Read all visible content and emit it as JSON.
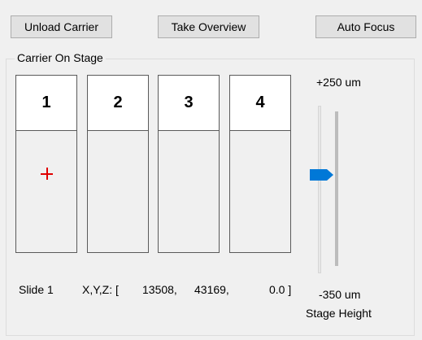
{
  "toolbar": {
    "unload_label": "Unload Carrier",
    "overview_label": "Take Overview",
    "autofocus_label": "Auto Focus"
  },
  "carrier": {
    "group_title": "Carrier On Stage",
    "slots": [
      {
        "label": "1",
        "selected": true
      },
      {
        "label": "2",
        "selected": false
      },
      {
        "label": "3",
        "selected": false
      },
      {
        "label": "4",
        "selected": false
      }
    ],
    "status": {
      "slide_text": "Slide 1",
      "xyz_label": "X,Y,Z: [",
      "x": "13508,",
      "y": "43169,",
      "z": "0.0 ]"
    }
  },
  "stage_height": {
    "max_label": "+250 um",
    "min_label": "-350 um",
    "caption": "Stage Height",
    "level_fraction": 0.65,
    "thumb_color": "#0078d7"
  },
  "colors": {
    "marker": "#e00000"
  }
}
